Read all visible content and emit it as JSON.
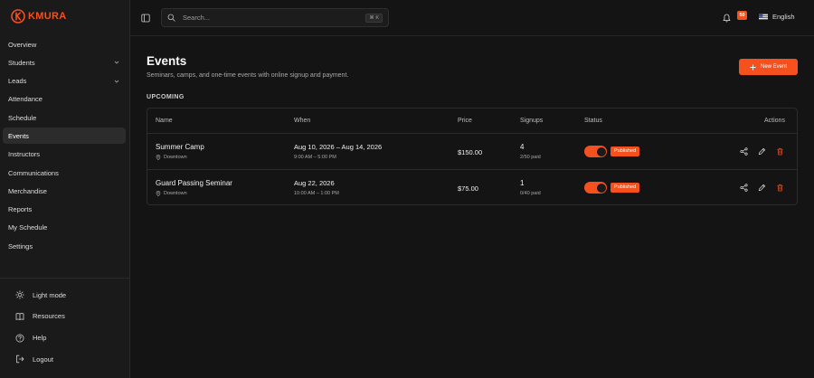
{
  "brand": {
    "name": "KMURA",
    "logo_letter": "K",
    "accent": "#f4511e"
  },
  "sidebar": {
    "items": [
      {
        "label": "Overview",
        "active": false,
        "expandable": false
      },
      {
        "label": "Students",
        "active": false,
        "expandable": true
      },
      {
        "label": "Leads",
        "active": false,
        "expandable": true
      },
      {
        "label": "Attendance",
        "active": false,
        "expandable": false
      },
      {
        "label": "Schedule",
        "active": false,
        "expandable": false
      },
      {
        "label": "Events",
        "active": true,
        "expandable": false
      },
      {
        "label": "Instructors",
        "active": false,
        "expandable": false
      },
      {
        "label": "Communications",
        "active": false,
        "expandable": false
      },
      {
        "label": "Merchandise",
        "active": false,
        "expandable": false
      },
      {
        "label": "Reports",
        "active": false,
        "expandable": false
      },
      {
        "label": "My Schedule",
        "active": false,
        "expandable": false
      },
      {
        "label": "Settings",
        "active": false,
        "expandable": false
      }
    ],
    "bottom": [
      {
        "label": "Light mode",
        "icon": "sun-icon"
      },
      {
        "label": "Resources",
        "icon": "book-icon"
      },
      {
        "label": "Help",
        "icon": "help-icon"
      },
      {
        "label": "Logout",
        "icon": "logout-icon"
      }
    ]
  },
  "topbar": {
    "search_placeholder": "Search...",
    "search_value": "",
    "shortcut": "⌘ K",
    "notification_count": "50",
    "language": "English"
  },
  "page": {
    "title": "Events",
    "subtitle": "Seminars, camps, and one-time events with online signup and payment.",
    "new_button": "New Event",
    "section": "UPCOMING"
  },
  "table": {
    "columns": {
      "name": "Name",
      "when": "When",
      "price": "Price",
      "signups": "Signups",
      "status": "Status",
      "actions": "Actions"
    },
    "rows": [
      {
        "name": "Summer Camp",
        "location": "Downtown",
        "date": "Aug 10, 2026 – Aug 14, 2026",
        "time": "9:00 AM – 5:00 PM",
        "price": "$150.00",
        "signups": "4",
        "paid": "2/50 paid",
        "published": true,
        "status": "Published"
      },
      {
        "name": "Guard Passing Seminar",
        "location": "Downtown",
        "date": "Aug 22, 2026",
        "time": "10:00 AM – 1:00 PM",
        "price": "$75.00",
        "signups": "1",
        "paid": "0/40 paid",
        "published": true,
        "status": "Published"
      }
    ]
  }
}
